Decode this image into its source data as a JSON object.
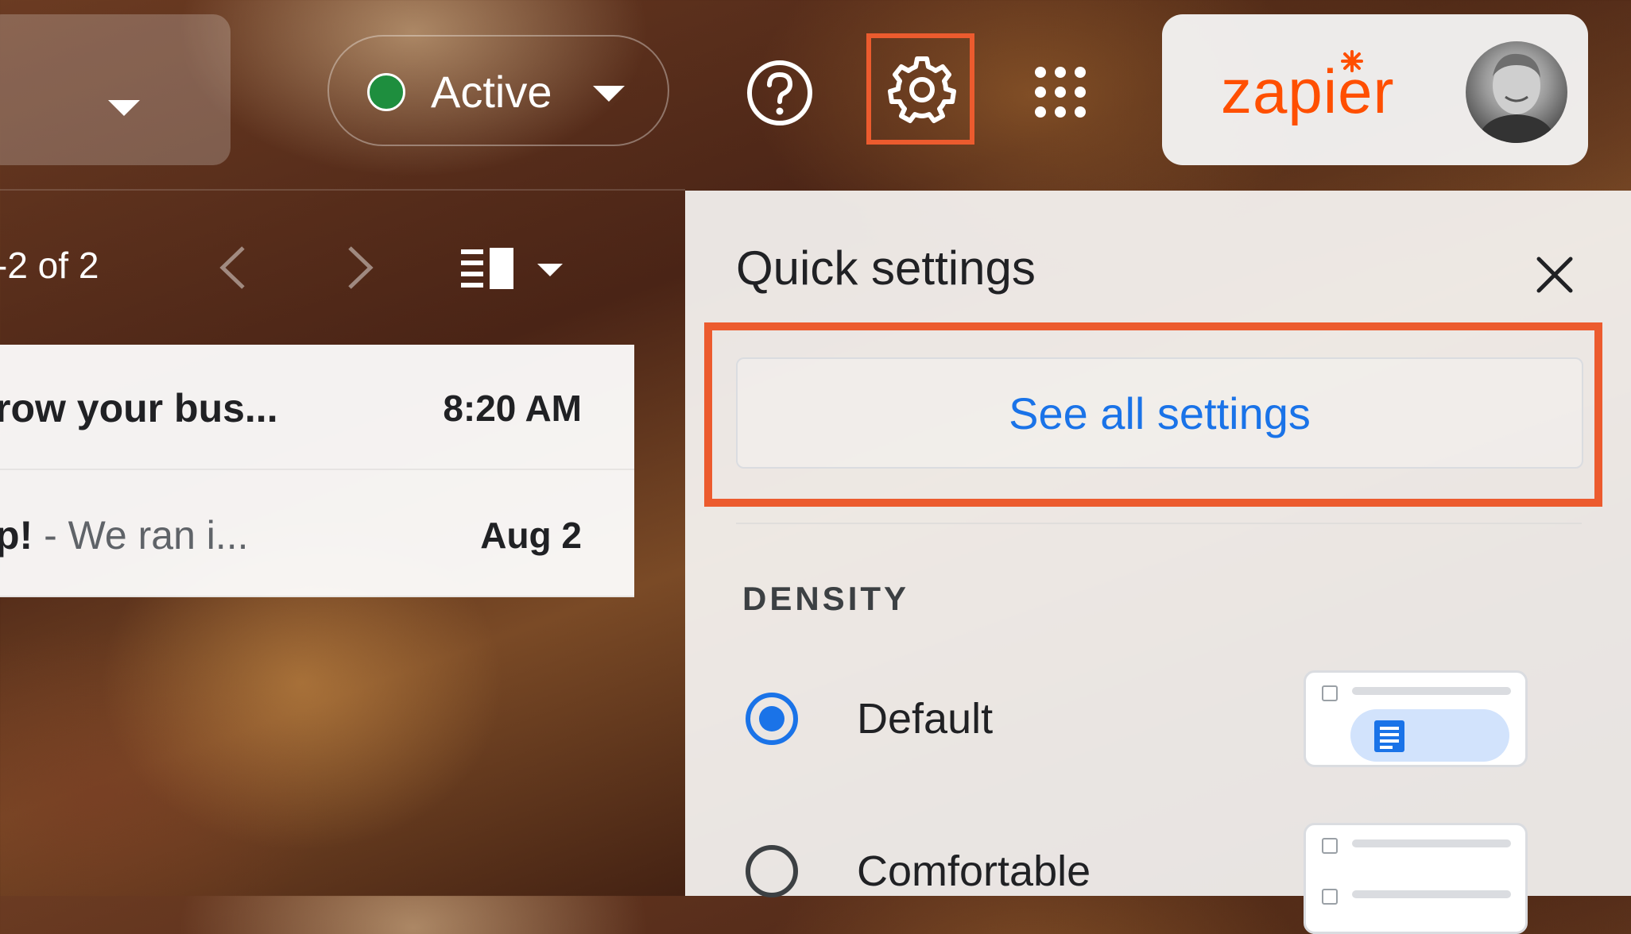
{
  "topbar": {
    "status_label": "Active",
    "status_color": "#1e8e3e",
    "icons": [
      "chevron-down-icon",
      "help-icon",
      "gear-icon",
      "apps-grid-icon"
    ],
    "highlight_color": "#ec5b2e",
    "account": {
      "brand_text": "zapier",
      "brand_color": "#ff4f00"
    }
  },
  "toolbar": {
    "pager_text": "-2 of 2",
    "icons": [
      "chevron-left-icon",
      "chevron-right-icon",
      "split-pane-icon",
      "caret-down-icon"
    ]
  },
  "mail": {
    "rows": [
      {
        "subject": "row your bus...",
        "snippet": "",
        "time": "8:20 AM"
      },
      {
        "subject": "p!",
        "snippet": " - We ran i...",
        "time": "Aug 2"
      }
    ]
  },
  "quick_settings": {
    "title": "Quick settings",
    "see_all_label": "See all settings",
    "link_color": "#1a73e8",
    "density_heading": "DENSITY",
    "options": [
      {
        "label": "Default",
        "selected": true
      },
      {
        "label": "Comfortable",
        "selected": false
      }
    ]
  }
}
